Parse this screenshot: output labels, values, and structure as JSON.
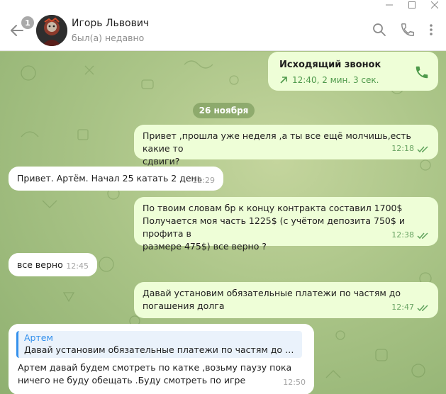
{
  "window": {
    "minimize_icon": "minimize-icon",
    "maximize_icon": "maximize-icon",
    "close_icon": "close-icon"
  },
  "header": {
    "back_badge": "1",
    "contact_name": "Игорь Львович",
    "status": "был(а) недавно",
    "icons": [
      "search-icon",
      "phone-icon",
      "more-vertical-icon"
    ]
  },
  "colors": {
    "outgoing_bubble": "#eefed7",
    "incoming_bubble": "#ffffff",
    "accent": "#4e9a4b",
    "reply_accent": "#3390ec",
    "chat_background": "#aac487"
  },
  "chat": {
    "call": {
      "title": "Исходящий звонок",
      "details": "12:40, 2 мин. 3 сек."
    },
    "date_label": "26 ноября",
    "messages": [
      {
        "direction": "out",
        "text": "Привет ,прошла уже неделя ,а ты все ещё молчишь,есть какие то\nсдвиги?",
        "time": "12:18",
        "read": true
      },
      {
        "direction": "in",
        "text": "Привет. Артём. Начал 25 катать 2 день",
        "time": "12:29"
      },
      {
        "direction": "out",
        "text": "По твоим словам бр к концу контракта составил 1700$\nПолучается моя часть 1225$ (с учётом депозита 750$ и профита в\nразмере 475$) все верно ?",
        "time": "12:38",
        "read": true
      },
      {
        "direction": "in",
        "text": "все верно",
        "time": "12:45"
      },
      {
        "direction": "out",
        "text": "Давай установим обязательные платежи по частям до\nпогашения долга",
        "time": "12:47",
        "read": true
      },
      {
        "direction": "in",
        "reply_author": "Артем",
        "reply_text": "Давай установим обязательные платежи по частям до пога...",
        "text": "Артем  давай будем смотреть по катке ,возьму паузу пока\nничего не буду обещать .Буду смотреть по игре",
        "time": "12:50"
      }
    ]
  }
}
